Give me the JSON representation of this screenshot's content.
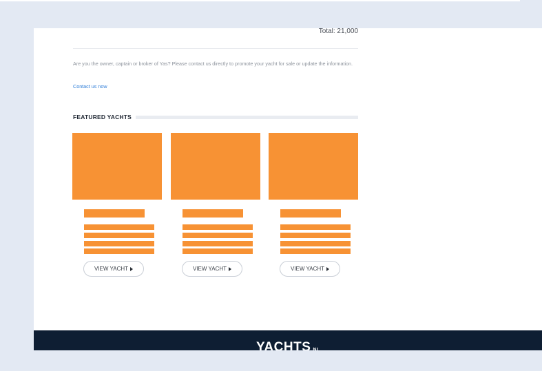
{
  "summary": {
    "total": "Total: 21,000"
  },
  "notice": {
    "text": "Are you the owner, captain or broker of Yas? Please contact us directly to promote your yacht for sale or update the information.",
    "contact_link": "Contact us now"
  },
  "featured": {
    "title": "FEATURED YACHTS",
    "cards": [
      {
        "button_label": "VIEW YACHT"
      },
      {
        "button_label": "VIEW YACHT"
      },
      {
        "button_label": "VIEW YACHT"
      }
    ]
  },
  "footer": {
    "logo_text": "YACHTS",
    "logo_suffix": "NL"
  },
  "colors": {
    "placeholder": "#f79234",
    "footer_bg": "#0e1e33",
    "link": "#2f7ed8",
    "page_bg": "#e3e9f3"
  }
}
